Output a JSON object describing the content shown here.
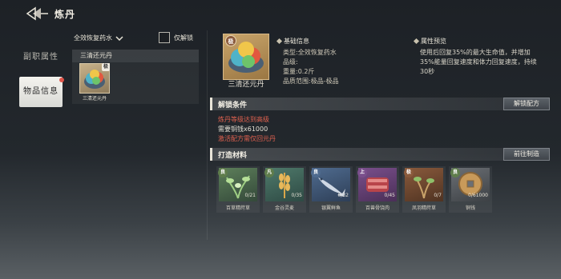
{
  "header": {
    "title": "炼丹"
  },
  "sidebar": {
    "tabs": [
      {
        "label": "副职属性"
      },
      {
        "label": "物品信息"
      }
    ]
  },
  "filter": {
    "category": "全效恢复药水",
    "only_unlocked_label": "仅解锁"
  },
  "list": {
    "header": "三清还元丹",
    "items": [
      {
        "name": "三清还元丹",
        "grade_badge": "极"
      }
    ]
  },
  "item": {
    "name": "三清还元丹",
    "grade_badge": "极",
    "basic_title": "基础信息",
    "type_line": "类型:全效恢复药水",
    "grade_line": "品级:",
    "weight_line": "重量:0.2斤",
    "quality_line": "品质范围:极品-极品",
    "preview_title": "属性预览",
    "preview_desc": "使用后回复35%的最大生命值，并增加35%能量回复速度和体力回复速度，持续30秒"
  },
  "unlock": {
    "title": "解锁条件",
    "button": "解锁配方",
    "conditions": [
      {
        "text": "炼丹等级达到高级",
        "color": "#e0614f"
      },
      {
        "text": "需要铜钱x61000",
        "color": "#e6e2d6"
      },
      {
        "text": "激活配方需仅回元丹",
        "color": "#e0614f"
      }
    ]
  },
  "craft": {
    "title": "打造材料",
    "button": "前往制造",
    "materials": [
      {
        "name": "百草精莳草",
        "badge": "良",
        "count": "0/21",
        "icon": "herb-icon"
      },
      {
        "name": "金谷灵麦",
        "badge": "凡",
        "count": "0/35",
        "icon": "wheat-icon"
      },
      {
        "name": "银翼鲜鱼",
        "badge": "良",
        "count": "0/32",
        "icon": "fish-icon"
      },
      {
        "name": "百兽骨饶肉",
        "badge": "上",
        "count": "0/45",
        "icon": "meat-icon"
      },
      {
        "name": "凤羽精莳草",
        "badge": "极",
        "count": "0/7",
        "icon": "herb-icon"
      },
      {
        "name": "铜钱",
        "badge": "良",
        "count": "0/61000",
        "icon": "coin-icon"
      }
    ]
  },
  "colors": {
    "accent_red": "#e0614f",
    "badge_brown": "#8a5a3c",
    "badge_green": "#5f7d4c",
    "badge_blue": "#4f6b8f",
    "badge_purple": "#7a4f8c"
  }
}
